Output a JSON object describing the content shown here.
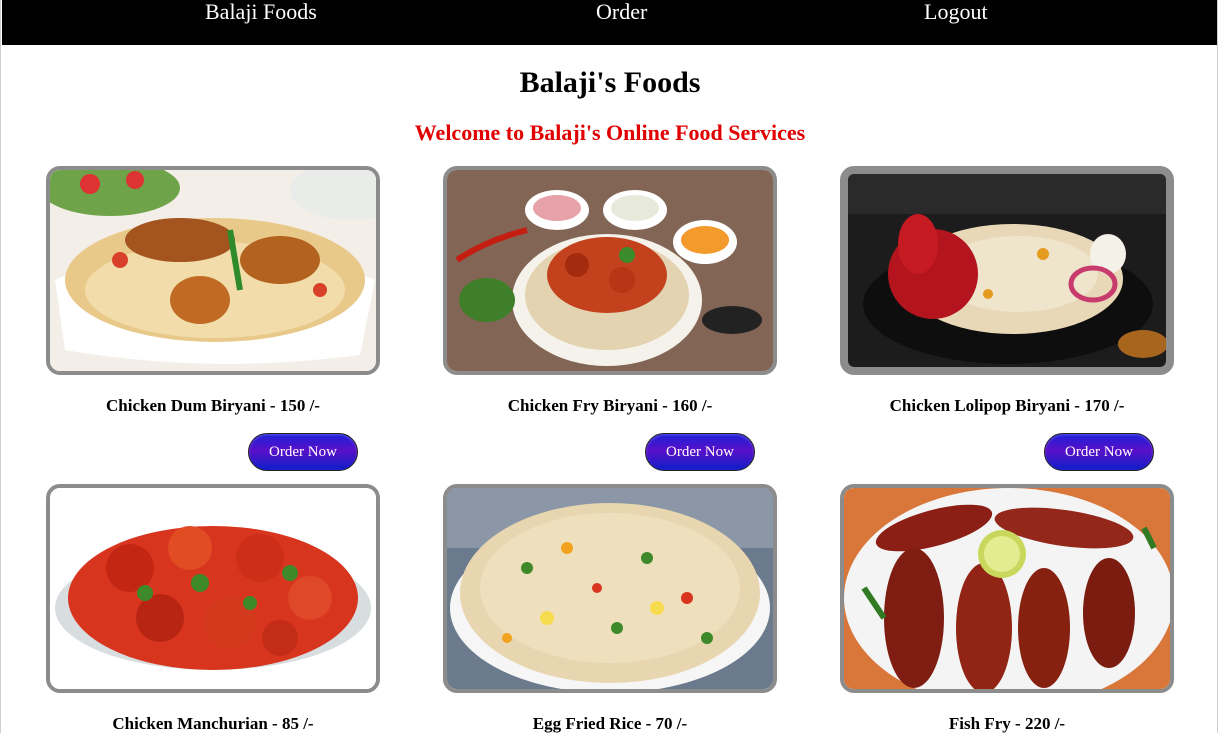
{
  "nav": {
    "brand": "Balaji Foods",
    "order": "Order",
    "logout": "Logout"
  },
  "page": {
    "title": "Balaji's Foods",
    "welcome": "Welcome to Balaji's Online Food Services"
  },
  "colors": {
    "navbar_bg": "#000000",
    "welcome_text": "#e00000",
    "button_gradient": [
      "#1d1fd9",
      "#5a10c8",
      "#0f1ec9"
    ],
    "photo_border": "#8c8c8c"
  },
  "items": [
    {
      "caption": "Chicken Dum Biryani - 150 /-",
      "button": "Order Now"
    },
    {
      "caption": "Chicken Fry Biryani - 160 /-",
      "button": "Order Now"
    },
    {
      "caption": "Chicken Lolipop Biryani - 170 /-",
      "button": "Order Now"
    },
    {
      "caption": "Chicken Manchurian - 85 /-"
    },
    {
      "caption": "Egg Fried Rice - 70 /-"
    },
    {
      "caption": "Fish Fry - 220 /-"
    }
  ]
}
